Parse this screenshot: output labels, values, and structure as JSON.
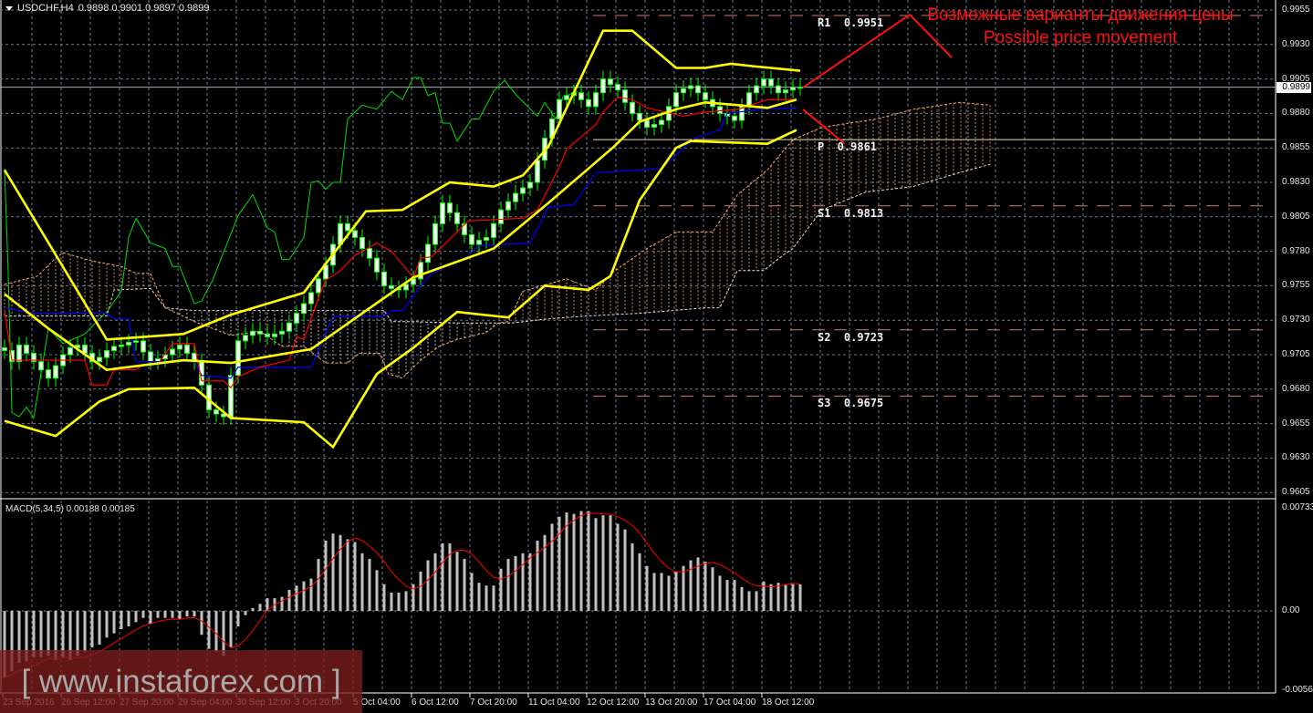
{
  "header": {
    "symbol": "USDCHF,H4",
    "ohlc": "0.9898 0.9901 0.9897 0.9899"
  },
  "price_axis": [
    "0.9955",
    "0.9930",
    "0.9905",
    "0.9880",
    "0.9855",
    "0.9830",
    "0.9805",
    "0.9780",
    "0.9755",
    "0.9730",
    "0.9705",
    "0.9680",
    "0.9655",
    "0.9630",
    "0.9605"
  ],
  "current_price": "0.9899",
  "macd_header": "MACD(5,34,5) 0.00188 0.00185",
  "macd_axis": [
    "0.00733",
    "0.00",
    "-0.00563"
  ],
  "time_axis": [
    "23 Sep 2016",
    "26 Sep 12:00",
    "27 Sep 20:00",
    "29 Sep 04:00",
    "30 Sep 12:00",
    "3 Oct 20:00",
    "5 Oct 04:00",
    "6 Oct 12:00",
    "7 Oct 20:00",
    "11 Oct 04:00",
    "12 Oct 12:00",
    "13 Oct 20:00",
    "17 Oct 04:00",
    "18 Oct 12:00"
  ],
  "pivots": [
    {
      "label": "R1  0.9951",
      "price": 0.9951
    },
    {
      "label": "P  0.9861",
      "price": 0.9861
    },
    {
      "label": "S1  0.9813",
      "price": 0.9813
    },
    {
      "label": "S2  0.9723",
      "price": 0.9723
    },
    {
      "label": "S3  0.9675",
      "price": 0.9675
    }
  ],
  "annotation": {
    "ru": "Возможные варианты движения цены",
    "en": "Possible price movement",
    "color": "#ff1010"
  },
  "watermark": "[ www.instaforex.com ]",
  "colors": {
    "bollinger": "#ffff00",
    "tenkan": "#ff0000",
    "kijun": "#0000ff",
    "chikou": "#00dd00",
    "spanA": "#f4a460",
    "spanB": "#e8d8d0",
    "candle_body": "#ffffff",
    "candle_wick": "#00ff00",
    "pivot": "#c88070",
    "pivot_p": "#ffd700"
  },
  "chart_data": {
    "type": "candlestick",
    "symbol": "USDCHF",
    "timeframe": "H4",
    "ylim": [
      0.9605,
      0.9955
    ],
    "x_unit": "bar index (H4)",
    "closes": [
      0.9708,
      0.97,
      0.9712,
      0.9706,
      0.97,
      0.9694,
      0.9688,
      0.9697,
      0.9705,
      0.971,
      0.9712,
      0.9706,
      0.97,
      0.9703,
      0.9708,
      0.9711,
      0.9712,
      0.9714,
      0.9715,
      0.9707,
      0.97,
      0.9702,
      0.9705,
      0.9709,
      0.9712,
      0.9706,
      0.97,
      0.9683,
      0.9665,
      0.9662,
      0.966,
      0.969,
      0.9715,
      0.9719,
      0.9722,
      0.972,
      0.9718,
      0.972,
      0.9722,
      0.9728,
      0.9735,
      0.9742,
      0.975,
      0.976,
      0.977,
      0.9785,
      0.98,
      0.9795,
      0.979,
      0.9782,
      0.9775,
      0.9765,
      0.9755,
      0.9753,
      0.9752,
      0.9756,
      0.976,
      0.9772,
      0.9785,
      0.98,
      0.9815,
      0.9808,
      0.98,
      0.9792,
      0.9785,
      0.9788,
      0.979,
      0.98,
      0.981,
      0.9816,
      0.9822,
      0.9826,
      0.983,
      0.9846,
      0.9862,
      0.9876,
      0.989,
      0.9893,
      0.9895,
      0.989,
      0.9885,
      0.9895,
      0.9905,
      0.9901,
      0.9897,
      0.9888,
      0.988,
      0.9875,
      0.987,
      0.9872,
      0.9875,
      0.9885,
      0.9895,
      0.9898,
      0.99,
      0.9895,
      0.989,
      0.9885,
      0.988,
      0.9878,
      0.9875,
      0.9885,
      0.9895,
      0.99,
      0.9905,
      0.99,
      0.9895,
      0.9897,
      0.9899,
      0.9899
    ],
    "first_open": 0.971,
    "bollinger": {
      "upper": [
        [
          0,
          0.9839
        ],
        [
          14,
          0.9716
        ],
        [
          24.5,
          0.972
        ],
        [
          31,
          0.9734
        ],
        [
          41,
          0.975
        ],
        [
          43,
          0.9764
        ],
        [
          49.5,
          0.9809
        ],
        [
          54.5,
          0.981
        ],
        [
          61,
          0.983
        ],
        [
          67,
          0.9827
        ],
        [
          71,
          0.9835
        ],
        [
          74.5,
          0.9856
        ],
        [
          82,
          0.994
        ],
        [
          86,
          0.994
        ],
        [
          92,
          0.9913
        ],
        [
          96,
          0.9913
        ],
        [
          99.5,
          0.9916
        ],
        [
          103,
          0.9914
        ],
        [
          109,
          0.9911
        ]
      ],
      "middle": [
        [
          0,
          0.9749
        ],
        [
          6,
          0.9724
        ],
        [
          14,
          0.9694
        ],
        [
          24.5,
          0.9701
        ],
        [
          31,
          0.9699
        ],
        [
          42,
          0.9709
        ],
        [
          56,
          0.9761
        ],
        [
          67,
          0.9782
        ],
        [
          74.5,
          0.9815
        ],
        [
          83.5,
          0.9856
        ],
        [
          87,
          0.9874
        ],
        [
          92,
          0.9883
        ],
        [
          96,
          0.9888
        ],
        [
          100.5,
          0.9886
        ],
        [
          104.5,
          0.9884
        ],
        [
          108.5,
          0.989
        ]
      ],
      "lower": [
        [
          0,
          0.9657
        ],
        [
          7,
          0.9646
        ],
        [
          13,
          0.9671
        ],
        [
          17,
          0.968
        ],
        [
          26,
          0.9681
        ],
        [
          31,
          0.9659
        ],
        [
          41,
          0.9656
        ],
        [
          45,
          0.9638
        ],
        [
          51,
          0.9691
        ],
        [
          56,
          0.971
        ],
        [
          62,
          0.9736
        ],
        [
          69,
          0.9732
        ],
        [
          74,
          0.9755
        ],
        [
          80,
          0.9752
        ],
        [
          83,
          0.9762
        ],
        [
          87,
          0.9817
        ],
        [
          92,
          0.9855
        ],
        [
          94,
          0.986
        ],
        [
          104.5,
          0.9858
        ],
        [
          108.5,
          0.9868
        ]
      ]
    },
    "ichimoku": {
      "tenkan": [
        [
          0,
          0.9737
        ],
        [
          1,
          0.9701
        ],
        [
          11,
          0.9701
        ],
        [
          12,
          0.9683
        ],
        [
          14,
          0.9683
        ],
        [
          15,
          0.9694
        ],
        [
          18,
          0.9694
        ],
        [
          19,
          0.9698
        ],
        [
          21,
          0.9698
        ],
        [
          23,
          0.9713
        ],
        [
          26,
          0.9713
        ],
        [
          27,
          0.9686
        ],
        [
          30,
          0.9686
        ],
        [
          31,
          0.9681
        ],
        [
          32,
          0.9689
        ],
        [
          35,
          0.9696
        ],
        [
          39,
          0.9701
        ],
        [
          40,
          0.9718
        ],
        [
          41,
          0.9716
        ],
        [
          43,
          0.9746
        ],
        [
          44,
          0.9759
        ],
        [
          46,
          0.9766
        ],
        [
          48,
          0.9777
        ],
        [
          51,
          0.9786
        ],
        [
          53,
          0.978
        ],
        [
          56,
          0.9761
        ],
        [
          57,
          0.9775
        ],
        [
          58.5,
          0.9776
        ],
        [
          63.5,
          0.9802
        ],
        [
          71,
          0.9804
        ],
        [
          73,
          0.981
        ],
        [
          76,
          0.9841
        ],
        [
          77,
          0.9854
        ],
        [
          81,
          0.9872
        ],
        [
          82,
          0.9881
        ],
        [
          84,
          0.9892
        ],
        [
          86,
          0.989
        ],
        [
          88,
          0.9884
        ],
        [
          93,
          0.9878
        ],
        [
          96,
          0.9881
        ],
        [
          100.5,
          0.9883
        ],
        [
          104.5,
          0.989
        ],
        [
          108.5,
          0.989
        ]
      ],
      "kijun": [
        [
          0,
          0.9739
        ],
        [
          4,
          0.9735
        ],
        [
          14,
          0.9735
        ],
        [
          15,
          0.9731
        ],
        [
          17,
          0.9731
        ],
        [
          18,
          0.97
        ],
        [
          26,
          0.97
        ],
        [
          27,
          0.969
        ],
        [
          31,
          0.9688
        ],
        [
          32,
          0.9696
        ],
        [
          42,
          0.9696
        ],
        [
          45,
          0.9733
        ],
        [
          52,
          0.9733
        ],
        [
          53,
          0.9737
        ],
        [
          54.5,
          0.9737
        ],
        [
          57,
          0.9755
        ],
        [
          58.5,
          0.9764
        ],
        [
          63,
          0.9775
        ],
        [
          65,
          0.9784
        ],
        [
          72,
          0.9786
        ],
        [
          74.5,
          0.9812
        ],
        [
          78,
          0.9814
        ],
        [
          81,
          0.9837
        ],
        [
          90,
          0.984
        ],
        [
          93,
          0.9855
        ],
        [
          94.5,
          0.9862
        ],
        [
          98,
          0.9868
        ],
        [
          99,
          0.988
        ],
        [
          103.5,
          0.9883
        ],
        [
          108.5,
          0.9884
        ]
      ],
      "chikou": [
        [
          0,
          0.984
        ],
        [
          0.5,
          0.9764
        ],
        [
          1,
          0.9663
        ],
        [
          2,
          0.966
        ],
        [
          3,
          0.9667
        ],
        [
          4,
          0.9659
        ],
        [
          6,
          0.9724
        ],
        [
          8,
          0.9713
        ],
        [
          11,
          0.972
        ],
        [
          13,
          0.9731
        ],
        [
          14,
          0.9736
        ],
        [
          16,
          0.9751
        ],
        [
          17,
          0.979
        ],
        [
          18,
          0.9804
        ],
        [
          20,
          0.9786
        ],
        [
          22,
          0.9782
        ],
        [
          23,
          0.9769
        ],
        [
          24,
          0.9769
        ],
        [
          26,
          0.9742
        ],
        [
          27,
          0.9744
        ],
        [
          28.5,
          0.9759
        ],
        [
          32,
          0.9806
        ],
        [
          34,
          0.9821
        ],
        [
          36,
          0.9797
        ],
        [
          37,
          0.9794
        ],
        [
          38,
          0.9774
        ],
        [
          39,
          0.9774
        ],
        [
          41,
          0.979
        ],
        [
          42,
          0.983
        ],
        [
          43,
          0.9831
        ],
        [
          44,
          0.9825
        ],
        [
          45,
          0.983
        ],
        [
          46,
          0.983
        ],
        [
          47,
          0.9876
        ],
        [
          49,
          0.9886
        ],
        [
          51,
          0.9883
        ],
        [
          53,
          0.9896
        ],
        [
          54.5,
          0.989
        ],
        [
          56,
          0.9906
        ],
        [
          57,
          0.9906
        ],
        [
          58,
          0.9893
        ],
        [
          59,
          0.9895
        ],
        [
          60,
          0.9873
        ],
        [
          61,
          0.9873
        ],
        [
          62,
          0.986
        ],
        [
          64,
          0.9876
        ],
        [
          65,
          0.9876
        ],
        [
          67,
          0.9896
        ],
        [
          68.5,
          0.9904
        ],
        [
          70,
          0.9894
        ],
        [
          73,
          0.9878
        ],
        [
          74,
          0.9888
        ],
        [
          75.5,
          0.9876
        ],
        [
          76.5,
          0.9892
        ],
        [
          78.5,
          0.9896
        ]
      ],
      "spanA": [
        [
          0,
          0.9756
        ],
        [
          4.5,
          0.9762
        ],
        [
          7,
          0.9775
        ],
        [
          8,
          0.9779
        ],
        [
          12,
          0.9773
        ],
        [
          16,
          0.9769
        ],
        [
          18,
          0.9764
        ],
        [
          20,
          0.9764
        ],
        [
          22,
          0.9739
        ],
        [
          26,
          0.9729
        ],
        [
          31,
          0.9719
        ],
        [
          35,
          0.9722
        ],
        [
          38,
          0.9711
        ],
        [
          41,
          0.9711
        ],
        [
          44,
          0.9699
        ],
        [
          47,
          0.9699
        ],
        [
          48.6,
          0.9706
        ],
        [
          51.4,
          0.9706
        ],
        [
          52.6,
          0.9691
        ],
        [
          54.5,
          0.9688
        ],
        [
          57,
          0.9701
        ],
        [
          59.5,
          0.9711
        ],
        [
          62,
          0.9716
        ],
        [
          66,
          0.9721
        ],
        [
          67.6,
          0.9728
        ],
        [
          69,
          0.9729
        ],
        [
          71,
          0.9751
        ],
        [
          73.6,
          0.9755
        ],
        [
          77,
          0.976
        ],
        [
          81,
          0.9752
        ],
        [
          83.6,
          0.9766
        ],
        [
          88,
          0.9782
        ],
        [
          92,
          0.9794
        ],
        [
          97,
          0.9794
        ],
        [
          100.4,
          0.9821
        ],
        [
          104.5,
          0.9839
        ],
        [
          108,
          0.9861
        ],
        [
          112,
          0.987
        ],
        [
          119.5,
          0.9876
        ],
        [
          124.5,
          0.9883
        ],
        [
          130.8,
          0.9888
        ],
        [
          135,
          0.9886
        ]
      ],
      "spanB": [
        [
          0,
          0.9733
        ],
        [
          14,
          0.9733
        ],
        [
          15,
          0.9752
        ],
        [
          20,
          0.9753
        ],
        [
          22,
          0.9739
        ],
        [
          26,
          0.9737
        ],
        [
          52,
          0.9737
        ],
        [
          53,
          0.9729
        ],
        [
          56,
          0.9729
        ],
        [
          62,
          0.9728
        ],
        [
          69.5,
          0.9728
        ],
        [
          74.5,
          0.9731
        ],
        [
          79.5,
          0.9733
        ],
        [
          87,
          0.9735
        ],
        [
          96,
          0.9739
        ],
        [
          98,
          0.9739
        ],
        [
          100.4,
          0.9766
        ],
        [
          104,
          0.9766
        ],
        [
          106.6,
          0.9777
        ],
        [
          108,
          0.9782
        ],
        [
          110.4,
          0.9799
        ],
        [
          112,
          0.981
        ],
        [
          118,
          0.9823
        ],
        [
          124.5,
          0.9827
        ],
        [
          130.8,
          0.9837
        ],
        [
          135,
          0.9843
        ]
      ]
    },
    "macd": {
      "params": "5,34,5",
      "ylim": [
        -0.00563,
        0.00733
      ],
      "signal_period": 5,
      "histogram": [
        -0.00476,
        -0.0043,
        -0.0037,
        -0.0036,
        -0.0033,
        -0.0033,
        -0.0032,
        -0.0035,
        -0.0033,
        -0.0035,
        -0.0032,
        -0.0029,
        -0.0026,
        -0.0024,
        -0.0019,
        -0.0016,
        -0.0013,
        -0.0011,
        -0.0008,
        -0.0005,
        -0.0009,
        -0.0005,
        -0.0005,
        -0.0005,
        -0.0006,
        -0.0004,
        -0.0004,
        -0.0017,
        -0.0027,
        -0.0029,
        -0.0032,
        -0.0026,
        -0.0011,
        -0.0003,
        0.0002,
        0.0005,
        0.0009,
        0.0009,
        0.001,
        0.0015,
        0.0018,
        0.0021,
        0.0023,
        0.0037,
        0.005,
        0.0055,
        0.0054,
        0.0051,
        0.0049,
        0.0041,
        0.0037,
        0.0029,
        0.0019,
        0.0013,
        0.0013,
        0.0014,
        0.0019,
        0.0028,
        0.0036,
        0.0041,
        0.0048,
        0.0048,
        0.0042,
        0.0037,
        0.0027,
        0.002,
        0.0018,
        0.0018,
        0.003,
        0.0037,
        0.0039,
        0.0041,
        0.0041,
        0.005,
        0.0054,
        0.0062,
        0.0067,
        0.007,
        0.0069,
        0.0071,
        0.0071,
        0.0066,
        0.0068,
        0.0068,
        0.0062,
        0.0058,
        0.0048,
        0.0041,
        0.0032,
        0.0027,
        0.0027,
        0.0025,
        0.0028,
        0.0032,
        0.0036,
        0.0038,
        0.0035,
        0.0031,
        0.0025,
        0.0022,
        0.0022,
        0.0017,
        0.0014,
        0.0014,
        0.0021,
        0.0019,
        0.002,
        0.0019,
        0.0019,
        0.00188
      ]
    }
  }
}
